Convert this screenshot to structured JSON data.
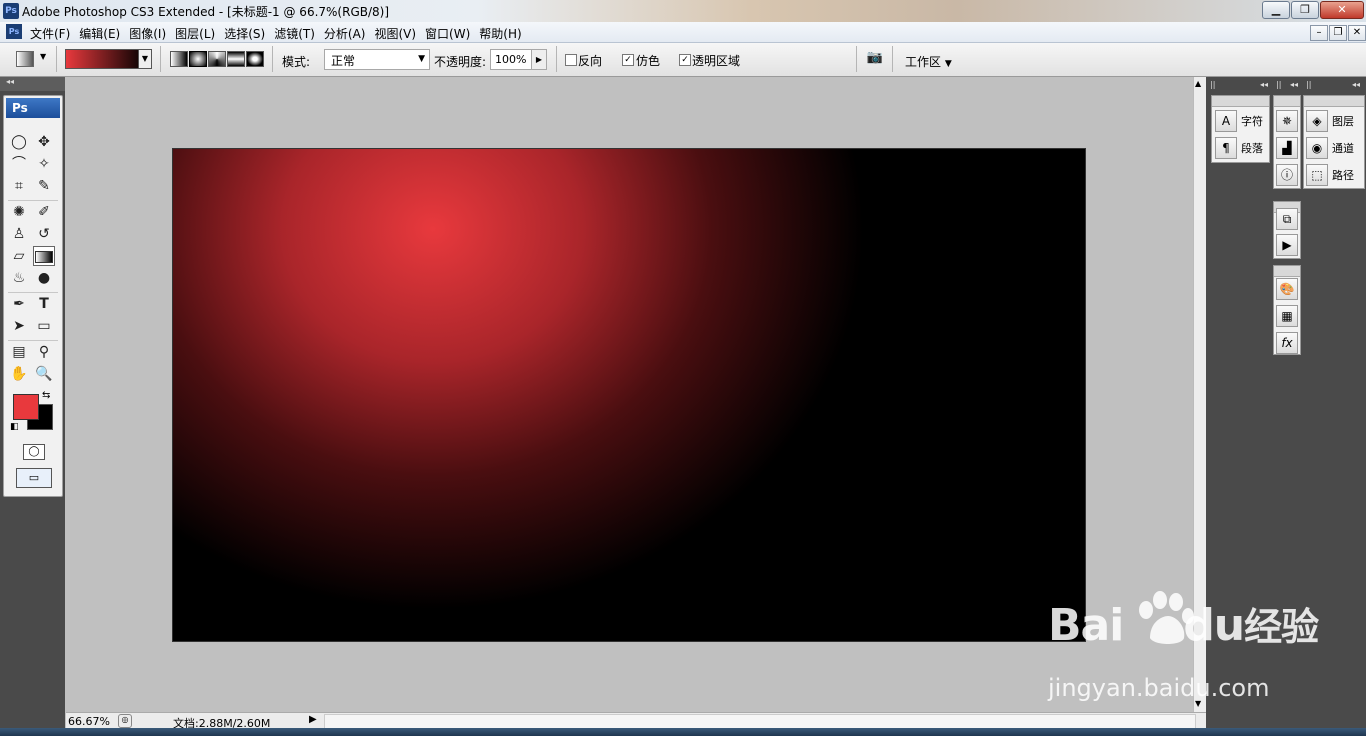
{
  "window": {
    "title": "Adobe Photoshop CS3 Extended - [未标题-1 @ 66.7%(RGB/8)]",
    "app_icon": "Ps"
  },
  "menu": [
    {
      "label": "文件(F)"
    },
    {
      "label": "编辑(E)"
    },
    {
      "label": "图像(I)"
    },
    {
      "label": "图层(L)"
    },
    {
      "label": "选择(S)"
    },
    {
      "label": "滤镜(T)"
    },
    {
      "label": "分析(A)"
    },
    {
      "label": "视图(V)"
    },
    {
      "label": "窗口(W)"
    },
    {
      "label": "帮助(H)"
    }
  ],
  "options": {
    "mode_label": "模式:",
    "mode_value": "正常",
    "opacity_label": "不透明度:",
    "opacity_value": "100%",
    "reverse_label": "反向",
    "dither_label": "仿色",
    "transparency_label": "透明区域",
    "workspace_label": "工作区",
    "gradient_colors": [
      "#e8393d",
      "#000000"
    ],
    "reverse_checked": false,
    "dither_checked": true,
    "transparency_checked": true
  },
  "toolbox": {
    "header": "Ps",
    "foreground": "#e8393d",
    "background": "#000000"
  },
  "panels": {
    "text_group": [
      {
        "label": "字符"
      },
      {
        "label": "段落"
      }
    ],
    "layers_group": [
      {
        "label": "图层"
      },
      {
        "label": "通道"
      },
      {
        "label": "路径"
      }
    ]
  },
  "status": {
    "zoom": "66.67%",
    "doc_info": "文档:2.88M/2.60M"
  },
  "canvas": {
    "gradient_type": "radial",
    "from": "#e8393d",
    "to": "#000000"
  },
  "watermark": {
    "brand": "Bai",
    "brand2": "du",
    "cn": "经验",
    "url": "jingyan.baidu.com"
  }
}
